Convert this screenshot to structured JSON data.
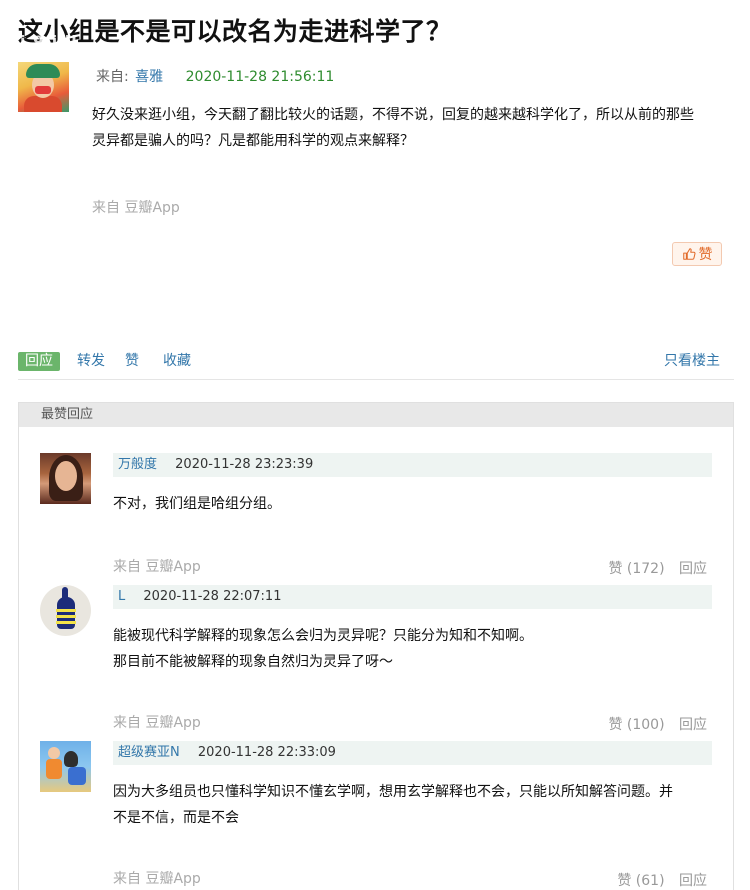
{
  "topic": {
    "title": "这小组是不是可以改名为走进科学了？",
    "watermark": "i 9  ijil"
  },
  "op": {
    "from_label": "来自:",
    "author": "喜雅",
    "time": "2020-11-28 21:56:11",
    "content_line1": "好久没来逛小组，今天翻了翻比较火的话题，不得不说，回复的越来越科学化了，所以从前的那些",
    "content_line2": "灵异都是骗人的吗？凡是都能用科学的观点来解释？",
    "source": "来自 豆瓣App",
    "like_label": "赞"
  },
  "actions": {
    "reply": "回应",
    "repost": "转发",
    "like": "赞",
    "collect": "收藏",
    "only_op": "只看楼主"
  },
  "best_replies": {
    "heading": "最赞回应",
    "items": [
      {
        "user": "万般度",
        "time": "2020-11-28 23:23:39",
        "line1": "不对，我们组是哈组分组。",
        "line2": "",
        "source": "来自 豆瓣App",
        "votes": "赞 (172)",
        "reply": "回应"
      },
      {
        "user": "L",
        "time": "2020-11-28 22:07:11",
        "line1": "能被现代科学解释的现象怎么会归为灵异呢？只能分为知和不知啊。",
        "line2": "那目前不能被解释的现象自然归为灵异了呀～",
        "source": "来自 豆瓣App",
        "votes": "赞 (100)",
        "reply": "回应"
      },
      {
        "user": "超级赛亚N",
        "time": "2020-11-28 22:33:09",
        "line1": "因为大多组员也只懂科学知识不懂玄学啊，想用玄学解释也不会，只能以所知解答问题。并",
        "line2": "不是不信，而是不会",
        "source": "来自 豆瓣App",
        "votes": "赞 (61)",
        "reply": "回应"
      }
    ]
  }
}
